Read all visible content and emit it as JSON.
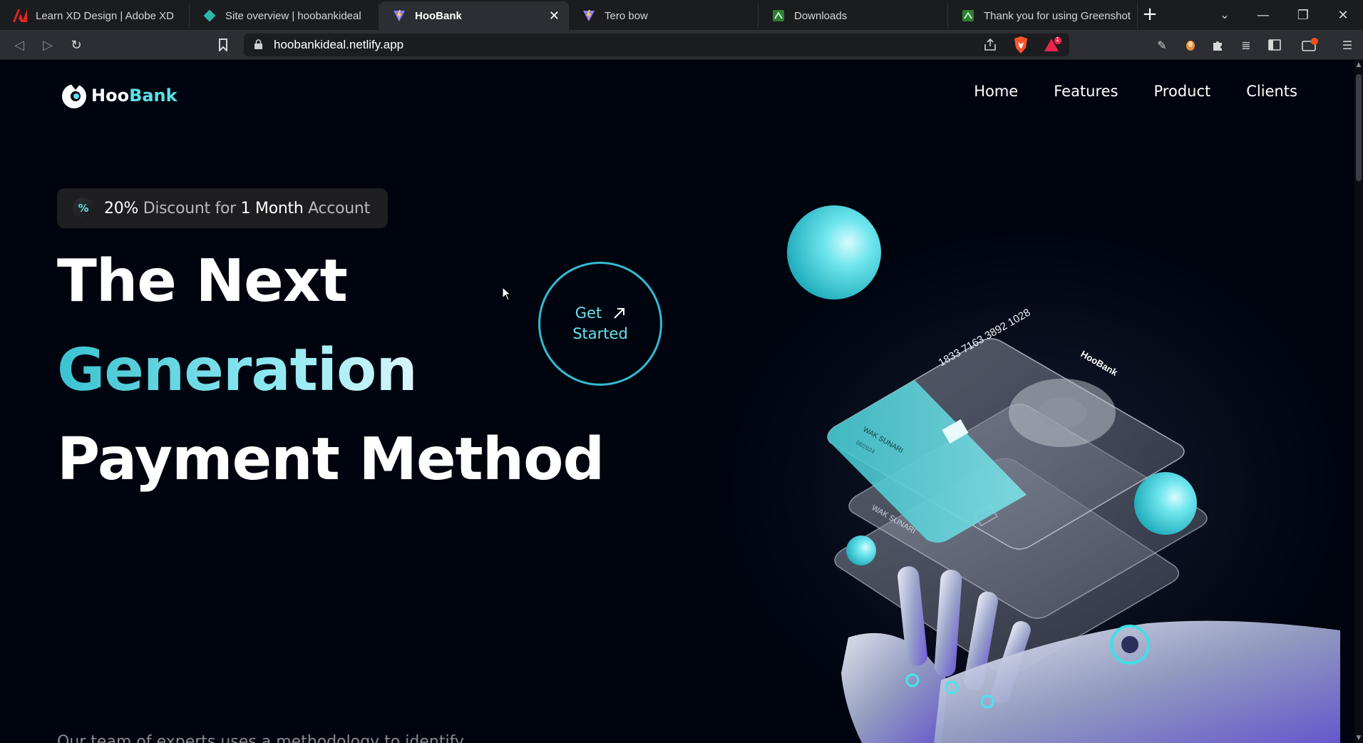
{
  "browser": {
    "tabs": [
      {
        "title": "Learn XD Design | Adobe XD",
        "icon": "adobe-icon",
        "active": false
      },
      {
        "title": "Site overview | hoobankideal",
        "icon": "netlify-icon",
        "active": false
      },
      {
        "title": "HooBank",
        "icon": "vite-icon",
        "active": true
      },
      {
        "title": "Tero bow",
        "icon": "vite-icon",
        "active": false
      },
      {
        "title": "Downloads",
        "icon": "greenshot-icon",
        "active": false
      },
      {
        "title": "Thank you for using Greenshot",
        "icon": "greenshot-icon",
        "active": false
      }
    ],
    "url": "hoobankideal.netlify.app",
    "brave_badge_count": "1",
    "colors": {
      "tabbar": "#1b1c1f",
      "toolbar": "#2c2e33",
      "urlbar": "#1c1d20"
    }
  },
  "page": {
    "logo": {
      "part1": "Hoo",
      "part2": "Bank"
    },
    "nav": [
      "Home",
      "Features",
      "Product",
      "Clients"
    ],
    "promo": {
      "icon": "discount-icon",
      "p1": "20%",
      "p2": " Discount for ",
      "p3": "1 Month",
      "p4": " Account"
    },
    "hero": {
      "line1": "The Next",
      "line2": "Generation",
      "line3": "Payment Method"
    },
    "cta": {
      "line1": "Get",
      "line2": "Started",
      "icon": "arrow-up-right-icon"
    },
    "subtext": "Our team of experts uses a methodology to identify",
    "card": {
      "number": "1833 7163 3892 1028",
      "holder": "WAK SUNARI",
      "expiry": "08/2024",
      "brand": "HooBank"
    },
    "colors": {
      "background": "#00040f",
      "accent": "#5ce1e6",
      "cta_border": "#33bbcf"
    }
  }
}
